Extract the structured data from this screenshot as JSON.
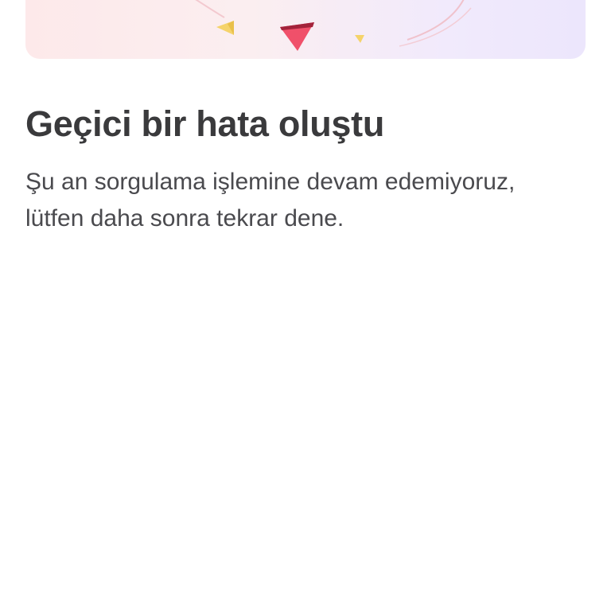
{
  "error": {
    "title": "Geçici bir hata oluştu",
    "message_line1": "Şu an sorgulama işlemine devam edemiyoruz,",
    "message_line2": "lütfen daha sonra tekrar dene."
  },
  "colors": {
    "title_text": "#3a3a3c",
    "body_text": "#4a4a4e",
    "accent_triangle": "#f0506a",
    "confetti_yellow": "#f5d36a"
  },
  "icons": {
    "illustration": "error-illustration-confetti"
  }
}
